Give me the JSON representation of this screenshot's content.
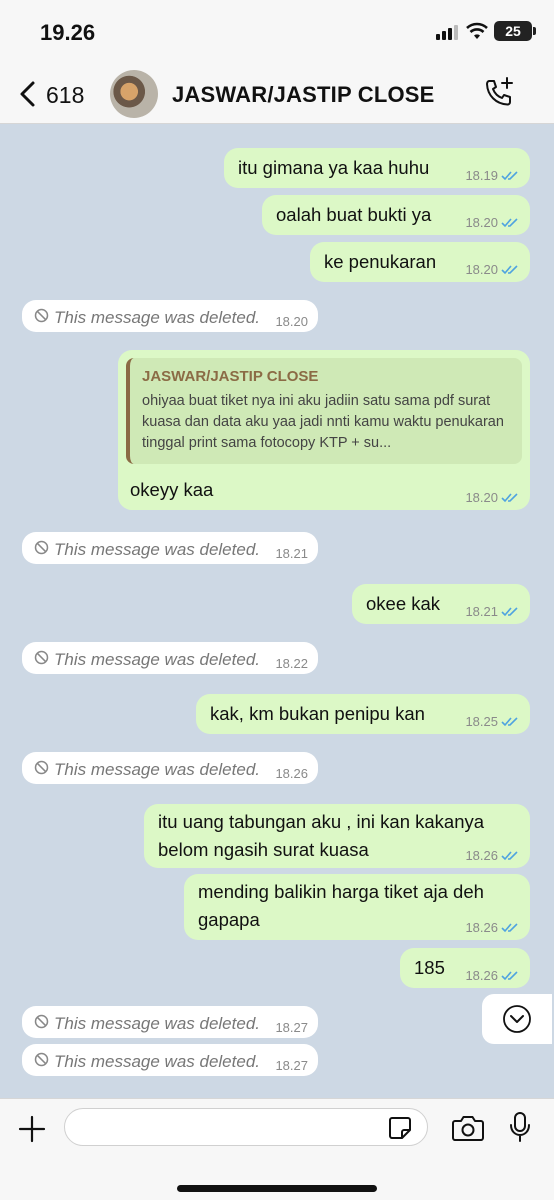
{
  "status_bar": {
    "time": "19.26",
    "battery": "25"
  },
  "header": {
    "back_count": "618",
    "contact_name": "JASWAR/JASTIP CLOSE",
    "icons": {
      "back": "chevron-left-icon",
      "call": "phone-add-icon"
    }
  },
  "messages": [
    {
      "type": "out",
      "text": "itu gimana ya kaa huhu",
      "time": "18.19",
      "read": true
    },
    {
      "type": "out",
      "text": "oalah buat bukti ya",
      "time": "18.20",
      "read": true
    },
    {
      "type": "out",
      "text": "ke penukaran",
      "time": "18.20",
      "read": true
    },
    {
      "type": "deleted",
      "text": "This message was deleted.",
      "time": "18.20"
    },
    {
      "type": "out-reply",
      "quote_author": "JASWAR/JASTIP CLOSE",
      "quote_text": "ohiyaa buat tiket nya ini aku jadiin satu sama pdf surat kuasa dan data aku yaa jadi nnti kamu waktu penukaran tinggal print sama fotocopy KTP + su...",
      "text": "okeyy kaa",
      "time": "18.20",
      "read": true
    },
    {
      "type": "deleted",
      "text": "This message was deleted.",
      "time": "18.21"
    },
    {
      "type": "out",
      "text": "okee kak",
      "time": "18.21",
      "read": true
    },
    {
      "type": "deleted",
      "text": "This message was deleted.",
      "time": "18.22"
    },
    {
      "type": "out",
      "text": "kak, km bukan penipu kan",
      "time": "18.25",
      "read": true
    },
    {
      "type": "deleted",
      "text": "This message was deleted.",
      "time": "18.26"
    },
    {
      "type": "out",
      "text_lines": [
        "itu uang tabungan aku , ini kan kakanya",
        "belom ngasih surat kuasa"
      ],
      "time": "18.26",
      "read": true
    },
    {
      "type": "out",
      "text_lines": [
        "mending balikin harga tiket aja deh",
        "gapapa"
      ],
      "time": "18.26",
      "read": true
    },
    {
      "type": "out",
      "text": "185",
      "time": "18.26",
      "read": true
    },
    {
      "type": "deleted",
      "text": "This message was deleted.",
      "time": "18.27"
    },
    {
      "type": "deleted",
      "text": "This message was deleted.",
      "time": "18.27"
    }
  ],
  "composer": {
    "value": "",
    "placeholder": ""
  },
  "colors": {
    "outgoing_bubble": "#dcf8c6",
    "incoming_bubble": "#ffffff",
    "chat_background": "#cdd8e4",
    "read_tick": "#4fa3e0",
    "quote_author": "#8b6b45"
  }
}
